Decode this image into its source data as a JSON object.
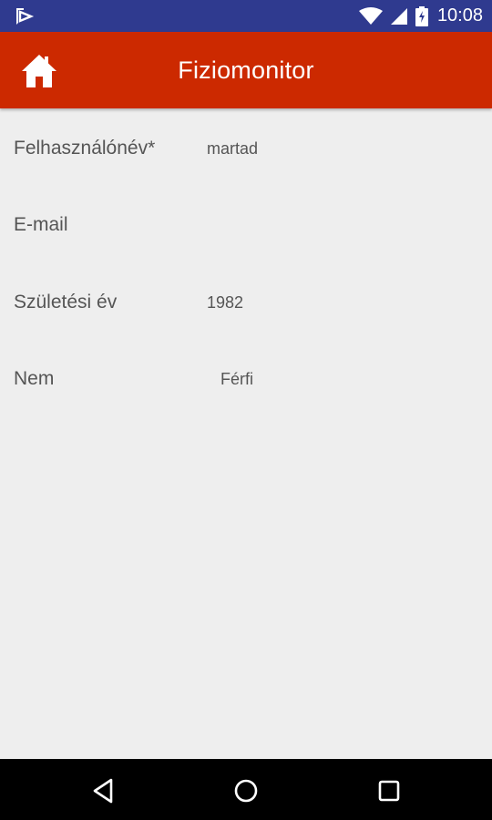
{
  "status_bar": {
    "time": "10:08",
    "icons": [
      "play-store-notification-icon",
      "wifi-icon",
      "signal-icon",
      "battery-icon"
    ]
  },
  "app_bar": {
    "title": "Fiziomonitor",
    "home_icon": "home-icon",
    "background": "#cc2900"
  },
  "profile": {
    "fields": [
      {
        "label": "Felhasználónév*",
        "value": "martad"
      },
      {
        "label": "E-mail",
        "value": ""
      },
      {
        "label": "Születési év",
        "value": "1982"
      },
      {
        "label": "Nem",
        "value": "Férfi"
      }
    ]
  },
  "nav_bar": {
    "icons": [
      "back-icon",
      "home-circle-icon",
      "recents-icon"
    ]
  },
  "colors": {
    "status_bar": "#2f3a8f",
    "app_bar": "#cc2900",
    "background": "#eeeeee",
    "text": "#555555"
  }
}
